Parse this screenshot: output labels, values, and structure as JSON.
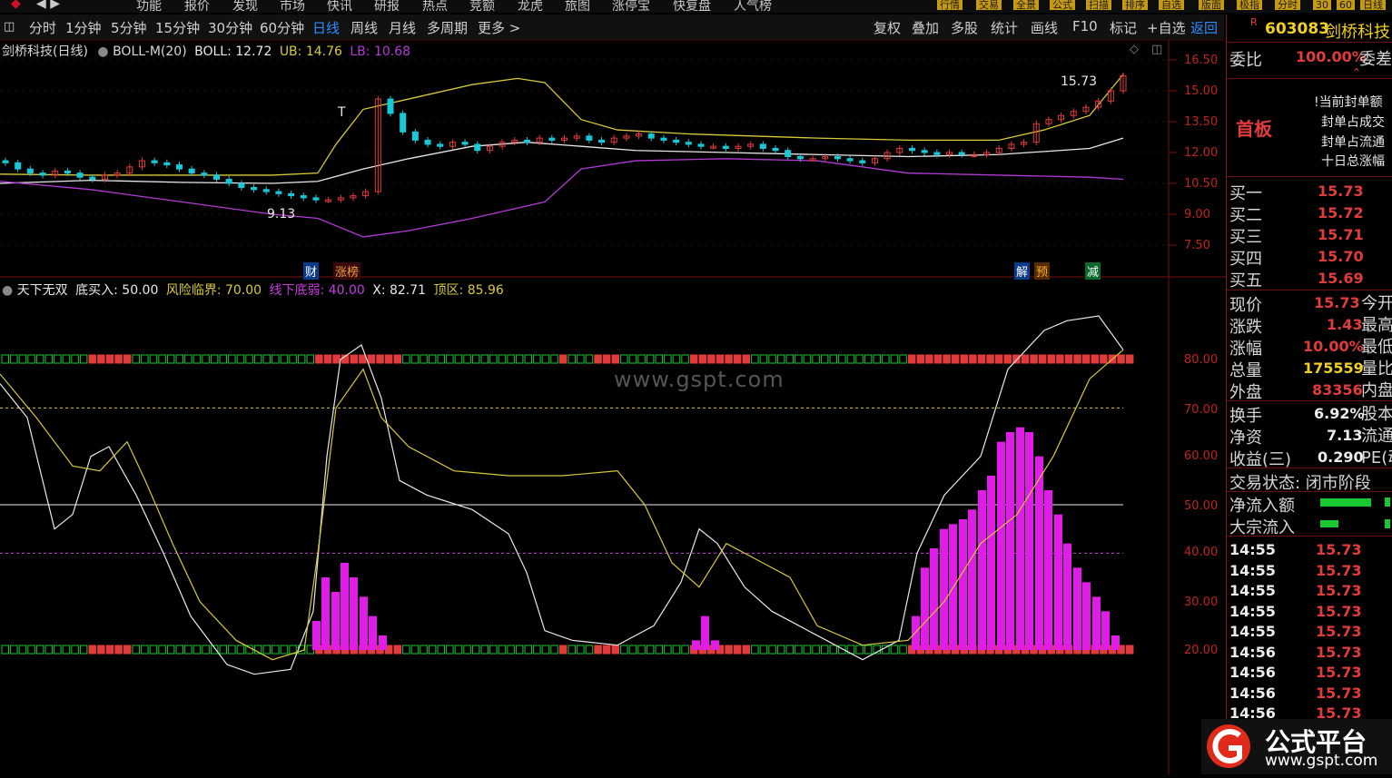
{
  "top_menu": [
    "功能",
    "报价",
    "发现",
    "市场",
    "快讯",
    "研报",
    "热点",
    "竞额",
    "龙虎",
    "旅图",
    "涨停宝",
    "快复盘",
    "人气榜"
  ],
  "top_buttons": [
    "行情",
    "交易",
    "全景",
    "公式",
    "扫描",
    "排序",
    "自选",
    "版面",
    "极指",
    "分时",
    "30",
    "60",
    "日线"
  ],
  "periods": [
    "分时",
    "1分钟",
    "5分钟",
    "15分钟",
    "30分钟",
    "60分钟",
    "日线",
    "周线",
    "月线",
    "多周期",
    "更多 >"
  ],
  "active_period": "日线",
  "right_tools": [
    "复权",
    "叠加",
    "多股",
    "统计",
    "画线",
    "F10",
    "标记",
    "+自选",
    "返回"
  ],
  "main_legend": {
    "name": "剑桥科技(日线)",
    "indicator": "BOLL-M(20)",
    "boll": "BOLL: 12.72",
    "ub": "UB: 14.76",
    "lb": "LB: 10.68"
  },
  "main_annotations": {
    "high": "15.73",
    "low": "9.13",
    "t_mark": "T"
  },
  "event_tags": [
    "财",
    "涨榜",
    "解",
    "预",
    "减"
  ],
  "main_yaxis": [
    "16.50",
    "15.00",
    "13.50",
    "12.00",
    "10.50",
    "9.00",
    "7.50"
  ],
  "sub_legend": {
    "name": "天下无双",
    "buy": "底买入: 50.00",
    "risk": "风险临界: 70.00",
    "weak": "线下底弱: 40.00",
    "x": "X: 82.71",
    "top": "顶区: 85.96"
  },
  "sub_yaxis": [
    "80.00",
    "70.00",
    "60.00",
    "50.00",
    "40.00",
    "30.00",
    "20.00"
  ],
  "watermark": "www.gspt.com",
  "stock": {
    "flag": "R",
    "code": "603083",
    "name": "剑桥科技"
  },
  "weibi": {
    "label": "委比",
    "value": "100.00%",
    "extra": "委差"
  },
  "first_board": {
    "label": "首板",
    "lines": [
      "!当前封单额",
      "封单占成交",
      "封单占流通",
      "十日总涨幅"
    ]
  },
  "bids": [
    {
      "label": "买一",
      "price": "15.73"
    },
    {
      "label": "买二",
      "price": "15.72"
    },
    {
      "label": "买三",
      "price": "15.71"
    },
    {
      "label": "买四",
      "price": "15.70"
    },
    {
      "label": "买五",
      "price": "15.69"
    }
  ],
  "quote": [
    {
      "label": "现价",
      "value": "15.73",
      "extra": "今开"
    },
    {
      "label": "涨跌",
      "value": "1.43",
      "extra": "最高"
    },
    {
      "label": "涨幅",
      "value": "10.00%",
      "extra": "最低"
    },
    {
      "label": "总量",
      "value": "175559",
      "extra": "量比"
    },
    {
      "label": "外盘",
      "value": "83356",
      "extra": "内盘"
    }
  ],
  "fundamentals": [
    {
      "label": "换手",
      "value": "6.92%",
      "extra": "股本"
    },
    {
      "label": "净资",
      "value": "7.13",
      "extra": "流通"
    },
    {
      "label": "收益(三)",
      "value": "0.290",
      "extra": "PE(动"
    }
  ],
  "trade_status": "交易状态: 闭市阶段",
  "flows": [
    {
      "label": "净流入额"
    },
    {
      "label": "大宗流入"
    }
  ],
  "ticks": [
    {
      "time": "14:55",
      "price": "15.73"
    },
    {
      "time": "14:55",
      "price": "15.73"
    },
    {
      "time": "14:55",
      "price": "15.73"
    },
    {
      "time": "14:55",
      "price": "15.73"
    },
    {
      "time": "14:55",
      "price": "15.73"
    },
    {
      "time": "14:56",
      "price": "15.73"
    },
    {
      "time": "14:56",
      "price": "15.73"
    },
    {
      "time": "14:56",
      "price": "15.73"
    },
    {
      "time": "14:56",
      "price": "15.73"
    }
  ],
  "logo": {
    "title": "公式平台",
    "url": "www.gspt.com"
  },
  "colors": {
    "up": "#e23b3b",
    "down": "#19c8d6",
    "ub": "#d7c93a",
    "lb": "#b23ad6",
    "mid": "#e8e8e8",
    "magenta": "#e01de6",
    "green": "#18c832"
  }
}
